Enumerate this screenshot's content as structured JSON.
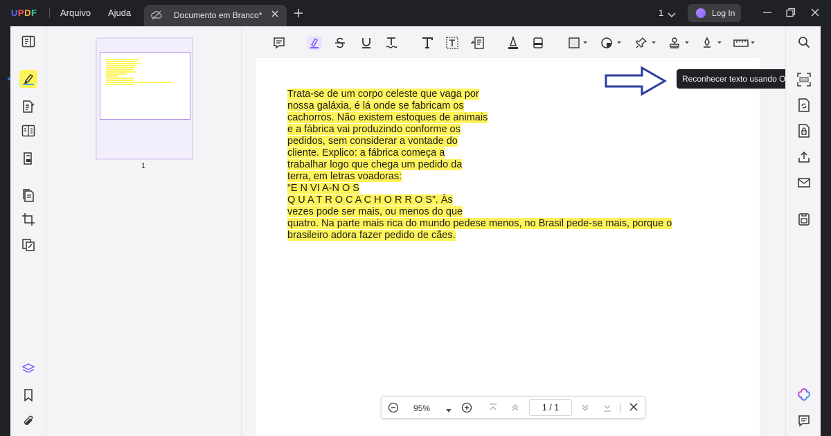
{
  "app": {
    "logo": "UPDF"
  },
  "menu": {
    "file": "Arquivo",
    "help": "Ajuda"
  },
  "tab": {
    "title": "Documento em Branco*"
  },
  "titlebar": {
    "page_count": "1",
    "login_label": "Log In"
  },
  "thumbnails": {
    "page_number": "1"
  },
  "document": {
    "lines": [
      "Trata-se de um corpo celeste que vaga por",
      "nossa galáxia, é lá onde se fabricam os",
      "cachorros. Não existem estoques de animais",
      "e a fábrica vai produzindo conforme os",
      "pedidos, sem considerar a vontade do",
      "cliente. Explico: a fábrica começa a",
      "trabalhar logo que chega um pedido da",
      "terra, em letras voadoras:",
      "“E N VI A-N O S",
      "Q U A T R O C A C H O R R O S”. Às",
      "vezes pode ser mais, ou menos do que",
      "quatro. Na parte mais rica do mundo pedese menos, no Brasil pede-se mais, porque o",
      "brasileiro adora fazer pedido de cães."
    ],
    "highlight_color": "#fff35a"
  },
  "tooltip": {
    "text": "Reconhecer texto usando OCR"
  },
  "bottom_nav": {
    "zoom": "95%",
    "page_indicator": "1 / 1"
  },
  "icons": {
    "left_rail": [
      "reader-icon",
      "comment-highlight-icon",
      "edit-pdf-icon",
      "form-icon",
      "fill-sign-icon",
      "organize-pages-icon",
      "crop-icon",
      "page-tools-icon",
      "layers-icon",
      "bookmark-icon",
      "attachment-icon"
    ],
    "toolbar": [
      "note-icon",
      "highlight-icon",
      "strikethrough-icon",
      "underline-icon",
      "squiggly-icon",
      "text-comment-icon",
      "text-box-icon",
      "callout-icon",
      "pencil-icon",
      "eraser-icon",
      "shape-icon",
      "sticker-icon",
      "pin-icon",
      "stamp-icon",
      "signature-icon",
      "measure-icon"
    ],
    "right_rail": [
      "search-icon",
      "ocr-icon",
      "convert-icon",
      "protect-icon",
      "share-icon",
      "email-icon",
      "save-icon",
      "ai-assistant-icon",
      "chat-icon"
    ]
  },
  "colors": {
    "accent": "#7c5cff",
    "highlight": "#fff35a",
    "arrow": "#2c3e9e"
  }
}
